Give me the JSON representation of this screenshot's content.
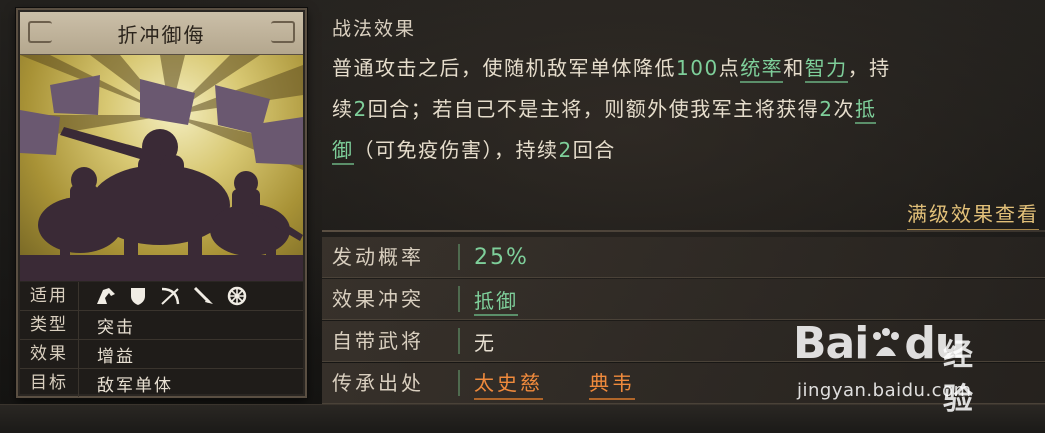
{
  "card": {
    "title": "折冲御侮",
    "applicable_label": "适用",
    "applicable_icons": [
      "cavalry-icon",
      "shield-icon",
      "bow-icon",
      "spear-icon",
      "wheel-icon"
    ],
    "type_label": "类型",
    "type_value": "突击",
    "effect_label": "效果",
    "effect_value": "增益",
    "target_label": "目标",
    "target_value": "敌军单体"
  },
  "skill": {
    "section_title": "战法效果",
    "line1_a": "普通攻击之后，使随机敌军单体降低",
    "line1_num": "100",
    "line1_b": "点",
    "line1_kw1": "统率",
    "line1_and": "和",
    "line1_kw2": "智力",
    "line1_c": "，持",
    "line2_a": "续",
    "line2_num1": "2",
    "line2_b": "回合；若自己不是主将，则额外使我军主将获得",
    "line2_num2": "2",
    "line2_c": "次",
    "line2_kw": "抵",
    "line3_kw": "御",
    "line3_a": "（可免疫伤害），持续",
    "line3_num": "2",
    "line3_b": "回合",
    "full_level_link": "满级效果查看"
  },
  "info": {
    "rate_label": "发动概率",
    "rate_value": "25%",
    "conflict_label": "效果冲突",
    "conflict_value": "抵御",
    "general_label": "自带武将",
    "general_value": "无",
    "inherit_label": "传承出处",
    "inherit_sources": [
      "太史慈",
      "典韦"
    ]
  },
  "watermark": {
    "logo": "Bai",
    "logo_suffix": "du",
    "cn": "经验",
    "url": "jingyan.baidu.com"
  }
}
